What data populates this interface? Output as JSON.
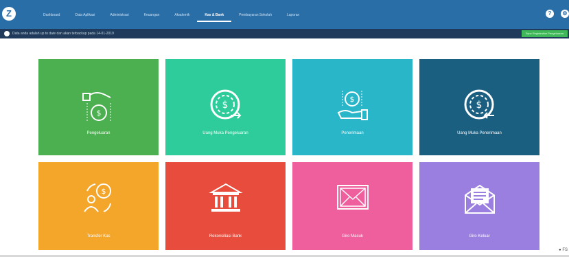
{
  "header": {
    "logo_text": "Z",
    "nav": [
      {
        "label": "Dashboard"
      },
      {
        "label": "Data Aplikasi"
      },
      {
        "label": "Administrasi"
      },
      {
        "label": "Keuangan"
      },
      {
        "label": "Akademik"
      },
      {
        "label": "Kas & Bank",
        "active": true
      },
      {
        "label": "Pembayaran Sekolah"
      },
      {
        "label": "Laporan"
      }
    ]
  },
  "infobar": {
    "text": "Data anda adalah up to date dan akan terbackup pada 14-01-2019",
    "link": "Sync Registration Pengeluaran"
  },
  "tiles": [
    {
      "label": "Pengeluaran",
      "color": "#4caf50"
    },
    {
      "label": "Uang Muka Pengeluaran",
      "color": "#2ecc9a"
    },
    {
      "label": "Penerimaan",
      "color": "#29b6c8"
    },
    {
      "label": "Uang Muka Penerimaan",
      "color": "#1b5f80"
    },
    {
      "label": "Transfer Kas",
      "color": "#f4a62a"
    },
    {
      "label": "Rekonsiliasi Bank",
      "color": "#e74c3c"
    },
    {
      "label": "Giro Masuk",
      "color": "#ef5f9e"
    },
    {
      "label": "Giro Keluar",
      "color": "#9b7fe0"
    }
  ]
}
